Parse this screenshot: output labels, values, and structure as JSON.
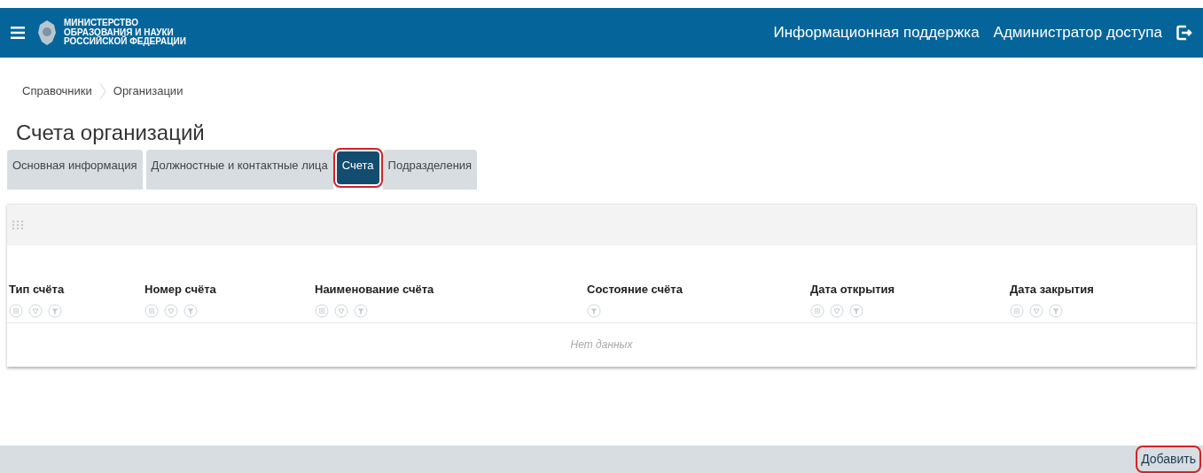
{
  "header": {
    "logo_lines": [
      "МИНИСТЕРСТВО",
      "ОБРАЗОВАНИЯ И НАУКИ",
      "РОССИЙСКОЙ ФЕДЕРАЦИИ"
    ],
    "links": [
      "Информационная поддержка",
      "Администратор доступа"
    ]
  },
  "breadcrumb": [
    "Справочники",
    "Организации"
  ],
  "page_title": "Счета организаций",
  "tabs": [
    {
      "label": "Основная информация",
      "selected": false,
      "highlighted": false
    },
    {
      "label": "Должностные и контактные лица",
      "selected": false,
      "highlighted": false
    },
    {
      "label": "Счета",
      "selected": true,
      "highlighted": true
    },
    {
      "label": "Подразделения",
      "selected": false,
      "highlighted": false
    }
  ],
  "table": {
    "columns": [
      {
        "label": "Тип счёта",
        "kind": "full"
      },
      {
        "label": "Номер счёта",
        "kind": "full"
      },
      {
        "label": "Наименование счёта",
        "kind": "full"
      },
      {
        "label": "Состояние счёта",
        "kind": "filter"
      },
      {
        "label": "Дата открытия",
        "kind": "full"
      },
      {
        "label": "Дата закрытия",
        "kind": "full"
      }
    ],
    "empty_text": "Нет данных"
  },
  "footer": {
    "button": {
      "label": "Добавить",
      "highlighted": true
    }
  }
}
